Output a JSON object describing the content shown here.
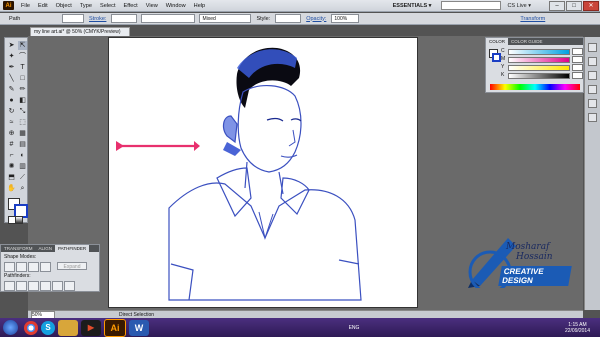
{
  "menubar": {
    "app_logo": "Ai",
    "items": [
      "File",
      "Edit",
      "Object",
      "Type",
      "Select",
      "Effect",
      "View",
      "Window",
      "Help"
    ],
    "workspace": "ESSENTIALS ▾",
    "cslive": "CS Live ▾"
  },
  "control": {
    "selection": "Path",
    "stroke_label": "Stroke:",
    "stroke_profile": "Mixed",
    "style_label": "Style:",
    "opacity_label": "Opacity:",
    "opacity_value": "100",
    "opacity_unit": "%",
    "transform": "Transform"
  },
  "document_tab": "my line art.ai* @ 50% (CMYK/Preview)",
  "color_panel": {
    "tabs": [
      "COLOR",
      "COLOR GUIDE"
    ],
    "channels": [
      "C",
      "M",
      "Y",
      "K"
    ]
  },
  "pathfinder": {
    "tabs": [
      "TRANSFORM",
      "ALIGN",
      "PATHFINDER"
    ],
    "shape_modes": "Shape Modes:",
    "expand": "Expand",
    "pathfinders": "Pathfinders:"
  },
  "status": {
    "zoom": "50%",
    "tool": "Direct Selection"
  },
  "watermark": {
    "line1": "Mosharaf",
    "line2": "Hossain",
    "line3": "CREATIVE DESIGN"
  },
  "taskbar": {
    "time": "1:15 AM",
    "date": "22/09/2014",
    "lang": "ENG",
    "apps": [
      "chrome",
      "skype",
      "explorer",
      "media",
      "illustrator",
      "word"
    ]
  }
}
